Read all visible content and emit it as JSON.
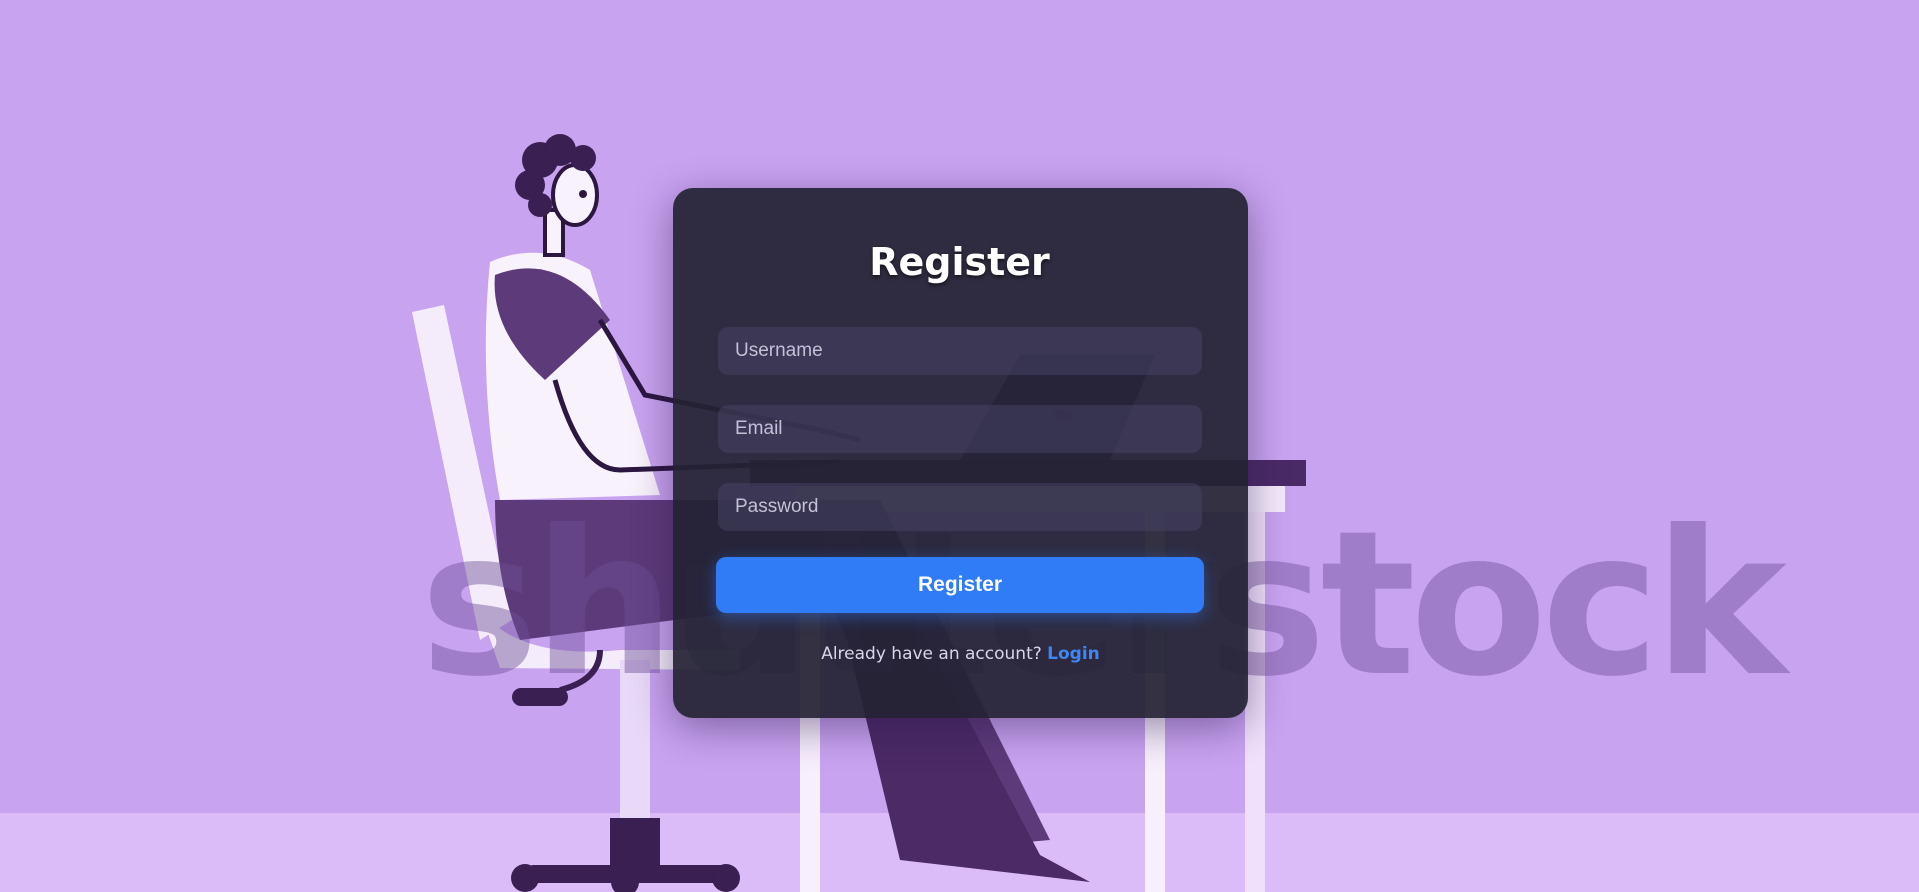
{
  "background": {
    "color": "#c8a3f0",
    "watermark": "shutterstock",
    "illustration": "person-at-desk-illustration"
  },
  "form": {
    "title": "Register",
    "username_placeholder": "Username",
    "email_placeholder": "Email",
    "password_placeholder": "Password",
    "submit_label": "Register",
    "footer_text": "Already have an account?",
    "login_link": "Login"
  },
  "colors": {
    "card": "#242234",
    "accent": "#2f7cf6",
    "link": "#3f86f5"
  }
}
